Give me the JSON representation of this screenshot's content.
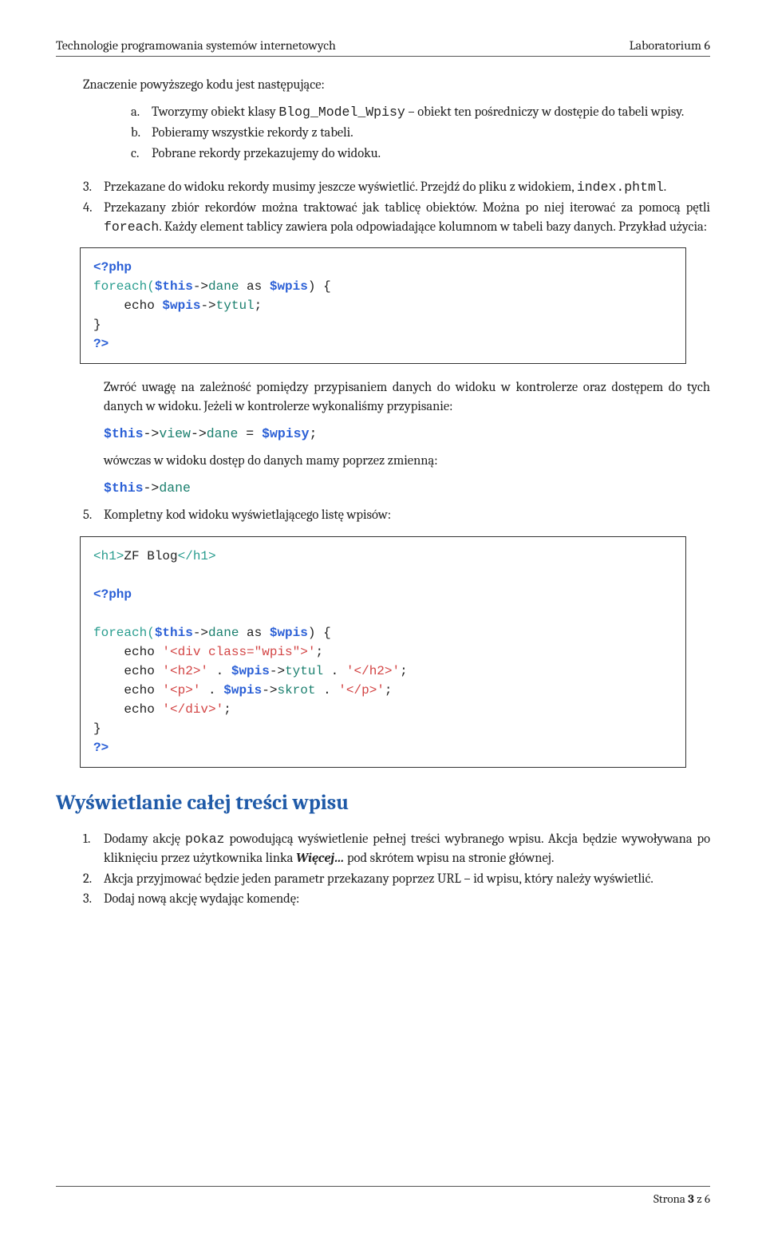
{
  "header": {
    "left": "Technologie programowania systemów internetowych",
    "right": "Laboratorium 6"
  },
  "intro": {
    "lead": "Znaczenie powyższego kodu jest następujące:",
    "a_pre": "Tworzymy obiekt klasy ",
    "a_mono": "Blog_Model_Wpisy",
    "a_post": " – obiekt ten pośredniczy w dostępie do tabeli wpisy.",
    "b": "Pobieramy wszystkie rekordy z tabeli.",
    "c": "Pobrane rekordy przekazujemy do widoku."
  },
  "sec1": {
    "item3_pre": "Przekazane do widoku rekordy musimy jeszcze wyświetlić. Przejdź do pliku z widokiem, ",
    "item3_mono": "index.phtml",
    "item3_post": ".",
    "item4_pre": "Przekazany zbiór rekordów można traktować jak tablicę obiektów. Można po niej iterować za pomocą pętli ",
    "item4_mono": "foreach",
    "item4_post": ". Każdy element tablicy zawiera pola odpowiadające kolumnom w tabeli bazy danych. Przykład użycia:"
  },
  "code1": {
    "l1a": "<?php",
    "l2a": "foreach(",
    "l2b": "$this",
    "l2c": "->",
    "l2d": "dane",
    "l2e": " as ",
    "l2f": "$wpis",
    "l2g": ") {",
    "l3a": "    echo ",
    "l3b": "$wpis",
    "l3c": "->",
    "l3d": "tytul",
    "l3e": ";",
    "l4": "}",
    "l5": "?>"
  },
  "sec2": {
    "p1": "Zwróć uwagę na zależność pomiędzy przypisaniem danych do widoku w kontrolerze oraz dostępem do tych danych w widoku. Jeżeli w kontrolerze wykonaliśmy przypisanie:",
    "line1_a": "$this",
    "line1_b": "->",
    "line1_c": "view",
    "line1_d": "->",
    "line1_e": "dane",
    "line1_f": " = ",
    "line1_g": "$wpisy",
    "line1_h": ";",
    "p2": "wówczas w widoku dostęp do danych mamy poprzez zmienną:",
    "line2_a": "$this",
    "line2_b": "->",
    "line2_c": "dane"
  },
  "item5": "Kompletny kod widoku wyświetlającego listę wpisów:",
  "code2": {
    "l0a": "<h1>",
    "l0b": "ZF Blog",
    "l0c": "</h1>",
    "blank1": "",
    "phpopen": "<?php",
    "blank2": "",
    "f1": "foreach(",
    "f2": "$this",
    "f3": "->",
    "f4": "dane",
    "f5": " as ",
    "f6": "$wpis",
    "f7": ") {",
    "e1a": "    echo ",
    "e1b": "'<div class=\"wpis\">'",
    "e1c": ";",
    "e2a": "    echo ",
    "e2b": "'<h2>'",
    "e2c": " . ",
    "e2d": "$wpis",
    "e2e": "->",
    "e2f": "tytul",
    "e2g": " . ",
    "e2h": "'</h2>'",
    "e2i": ";",
    "e3a": "    echo ",
    "e3b": "'<p>'",
    "e3c": " . ",
    "e3d": "$wpis",
    "e3e": "->",
    "e3f": "skrot",
    "e3g": " . ",
    "e3h": "'</p>'",
    "e3i": ";",
    "e4a": "    echo ",
    "e4b": "'</div>'",
    "e4c": ";",
    "close": "}",
    "phpclose": "?>"
  },
  "h2": "Wyświetlanie całej treści wpisu",
  "sec3": {
    "i1_pre": "Dodamy akcję ",
    "i1_mono": "pokaz",
    "i1_mid": " powodującą wyświetlenie pełnej treści wybranego wpisu. Akcja będzie wywoływana po kliknięciu przez użytkownika linka ",
    "i1_em": "Więcej…",
    "i1_post": " pod skrótem wpisu na stronie głównej.",
    "i2": "Akcja przyjmować będzie jeden parametr przekazany poprzez URL – id wpisu, który należy wyświetlić.",
    "i3": "Dodaj nową akcję wydając komendę:"
  },
  "footer": {
    "left": "Strona ",
    "num": "3",
    "mid": " z ",
    "total": "6"
  }
}
